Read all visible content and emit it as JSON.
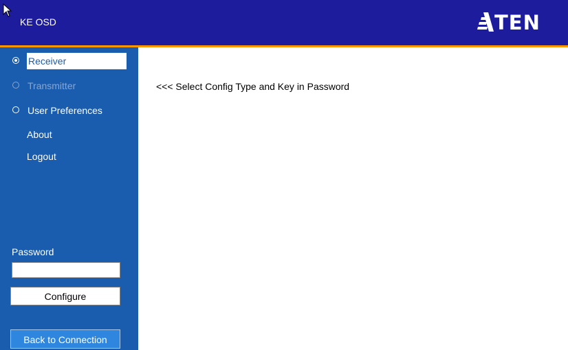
{
  "header": {
    "title": "KE OSD",
    "logo_text": "TEN",
    "logo_full": "ATEN",
    "bg_color": "#1c1c9c",
    "accent_color": "#ff9800"
  },
  "sidebar": {
    "bg_color": "#1a5cad",
    "options": [
      {
        "label": "Receiver",
        "selected": true,
        "disabled": false
      },
      {
        "label": "Transmitter",
        "selected": false,
        "disabled": true
      },
      {
        "label": "User Preferences",
        "selected": false,
        "disabled": false
      }
    ],
    "links": [
      {
        "label": "About"
      },
      {
        "label": "Logout"
      }
    ],
    "password": {
      "label": "Password",
      "value": ""
    },
    "configure_label": "Configure",
    "back_label": "Back to Connection"
  },
  "main": {
    "message": "<<< Select Config Type and Key in Password"
  }
}
